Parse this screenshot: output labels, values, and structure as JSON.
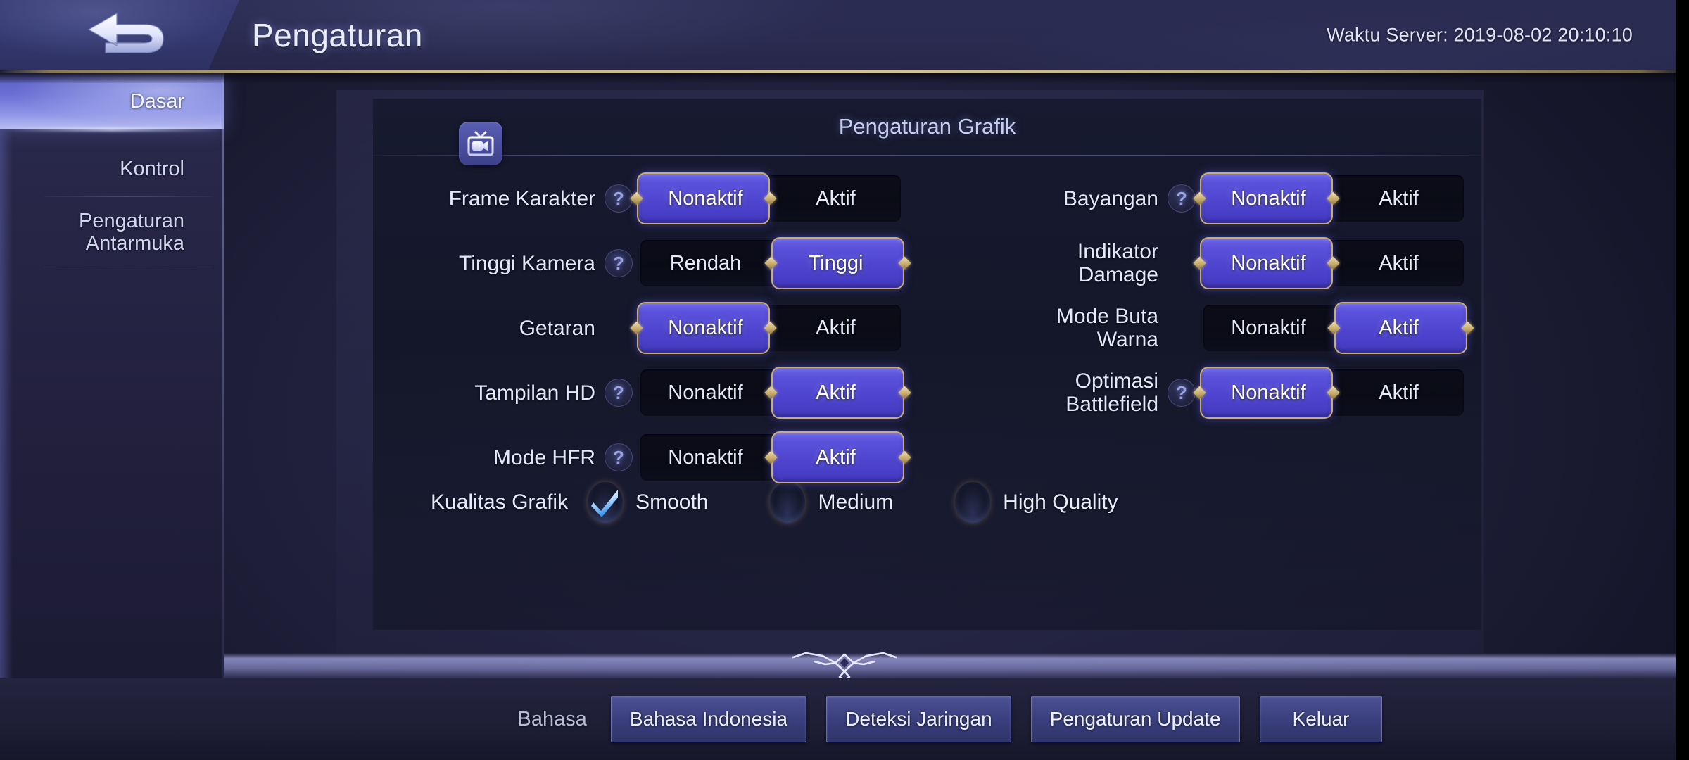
{
  "header": {
    "back_icon": "back-arrow-icon",
    "title": "Pengaturan",
    "server_time": "Waktu Server: 2019-08-02 20:10:10"
  },
  "sidebar": {
    "items": [
      {
        "label": "Dasar",
        "active": true
      },
      {
        "label": "Kontrol",
        "active": false
      },
      {
        "label": "Pengaturan\nAntarmuka",
        "active": false
      }
    ]
  },
  "panel": {
    "title": "Pengaturan Grafik",
    "badge_icon": "tv-camera-icon",
    "left_rows": [
      {
        "label": "Frame Karakter",
        "help": true,
        "options": [
          "Nonaktif",
          "Aktif"
        ],
        "selected": 0
      },
      {
        "label": "Tinggi Kamera",
        "help": true,
        "options": [
          "Rendah",
          "Tinggi"
        ],
        "selected": 1
      },
      {
        "label": "Getaran",
        "help": false,
        "options": [
          "Nonaktif",
          "Aktif"
        ],
        "selected": 0
      },
      {
        "label": "Tampilan HD",
        "help": true,
        "options": [
          "Nonaktif",
          "Aktif"
        ],
        "selected": 1
      },
      {
        "label": "Mode HFR",
        "help": true,
        "options": [
          "Nonaktif",
          "Aktif"
        ],
        "selected": 1
      }
    ],
    "right_rows": [
      {
        "label": "Bayangan",
        "help": true,
        "options": [
          "Nonaktif",
          "Aktif"
        ],
        "selected": 0
      },
      {
        "label": "Indikator\nDamage",
        "help": false,
        "options": [
          "Nonaktif",
          "Aktif"
        ],
        "selected": 0
      },
      {
        "label": "Mode Buta\nWarna",
        "help": false,
        "options": [
          "Nonaktif",
          "Aktif"
        ],
        "selected": 1
      },
      {
        "label": "Optimasi\nBattlefield",
        "help": true,
        "options": [
          "Nonaktif",
          "Aktif"
        ],
        "selected": 0
      }
    ],
    "quality": {
      "label": "Kualitas Grafik",
      "options": [
        {
          "label": "Smooth",
          "checked": true
        },
        {
          "label": "Medium",
          "checked": false
        },
        {
          "label": "High Quality",
          "checked": false
        }
      ]
    },
    "help_glyph": "?"
  },
  "bottom": {
    "language_label": "Bahasa",
    "buttons": [
      "Bahasa Indonesia",
      "Deteksi Jaringan",
      "Pengaturan Update",
      "Keluar"
    ]
  },
  "colors": {
    "accent_purple": "#4e44cf",
    "accent_gold": "#c7ad6e",
    "text_primary": "#e8ecfb",
    "panel_bg": "#141729",
    "sidebar_active": "#6a6fd4"
  }
}
